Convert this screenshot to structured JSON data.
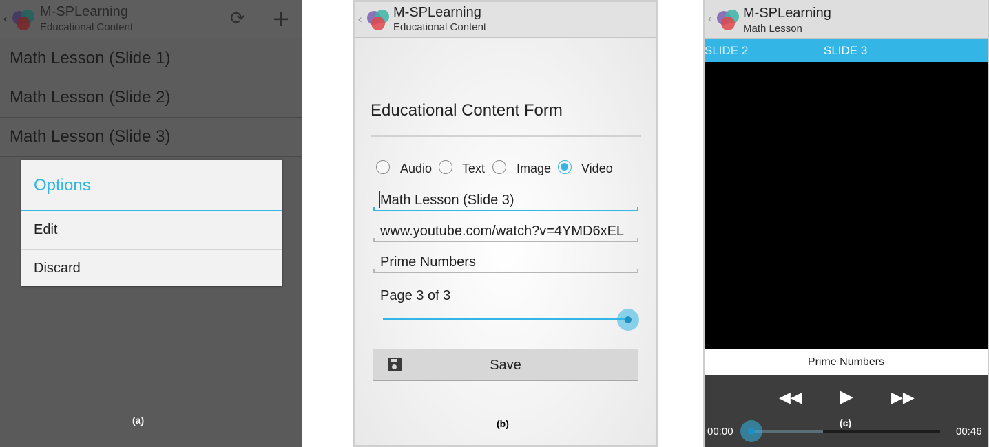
{
  "panel_a": {
    "app_title": "M-SPLearning",
    "app_subtitle": "Educational Content",
    "back_glyph": "‹",
    "actions": [
      {
        "name": "refresh-icon",
        "glyph": "⟳"
      },
      {
        "name": "add-icon",
        "glyph": "+"
      }
    ],
    "list_items": [
      "Math Lesson (Slide 1)",
      "Math Lesson (Slide 2)",
      "Math Lesson (Slide 3)"
    ],
    "dialog": {
      "title": "Options",
      "items": [
        "Edit",
        "Discard"
      ]
    },
    "caption": "(a)"
  },
  "panel_b": {
    "app_title": "M-SPLearning",
    "app_subtitle": "Educational Content",
    "back_glyph": "‹",
    "form_title": "Educational Content Form",
    "content_types": [
      {
        "label": "Audio",
        "checked": false
      },
      {
        "label": "Text",
        "checked": false
      },
      {
        "label": "Image",
        "checked": false
      },
      {
        "label": "Video",
        "checked": true
      }
    ],
    "fields": {
      "title_value": "Math Lesson (Slide 3)",
      "url_value": "www.youtube.com/watch?v=4YMD6xEL",
      "topic_value": "Prime Numbers"
    },
    "page_label": "Page 3 of 3",
    "slider_fraction": 1.0,
    "save_label": "Save",
    "caption": "(b)"
  },
  "panel_c": {
    "app_title": "M-SPLearning",
    "app_subtitle": "Math Lesson",
    "back_glyph": "‹",
    "tabs": {
      "previous": "SLIDE 2",
      "current": "SLIDE 3"
    },
    "video_title": "Prime Numbers",
    "controls": {
      "rewind": "◀◀",
      "play": "▶",
      "fast_forward": "▶▶"
    },
    "time_current": "00:00",
    "time_total": "00:46",
    "played_fraction": 0.0,
    "buffered_fraction": 0.38,
    "caption": "(c)"
  },
  "colors": {
    "accent": "#33b5e5",
    "dim_overlay": "#5a5a5a",
    "video_bg": "#000000"
  }
}
